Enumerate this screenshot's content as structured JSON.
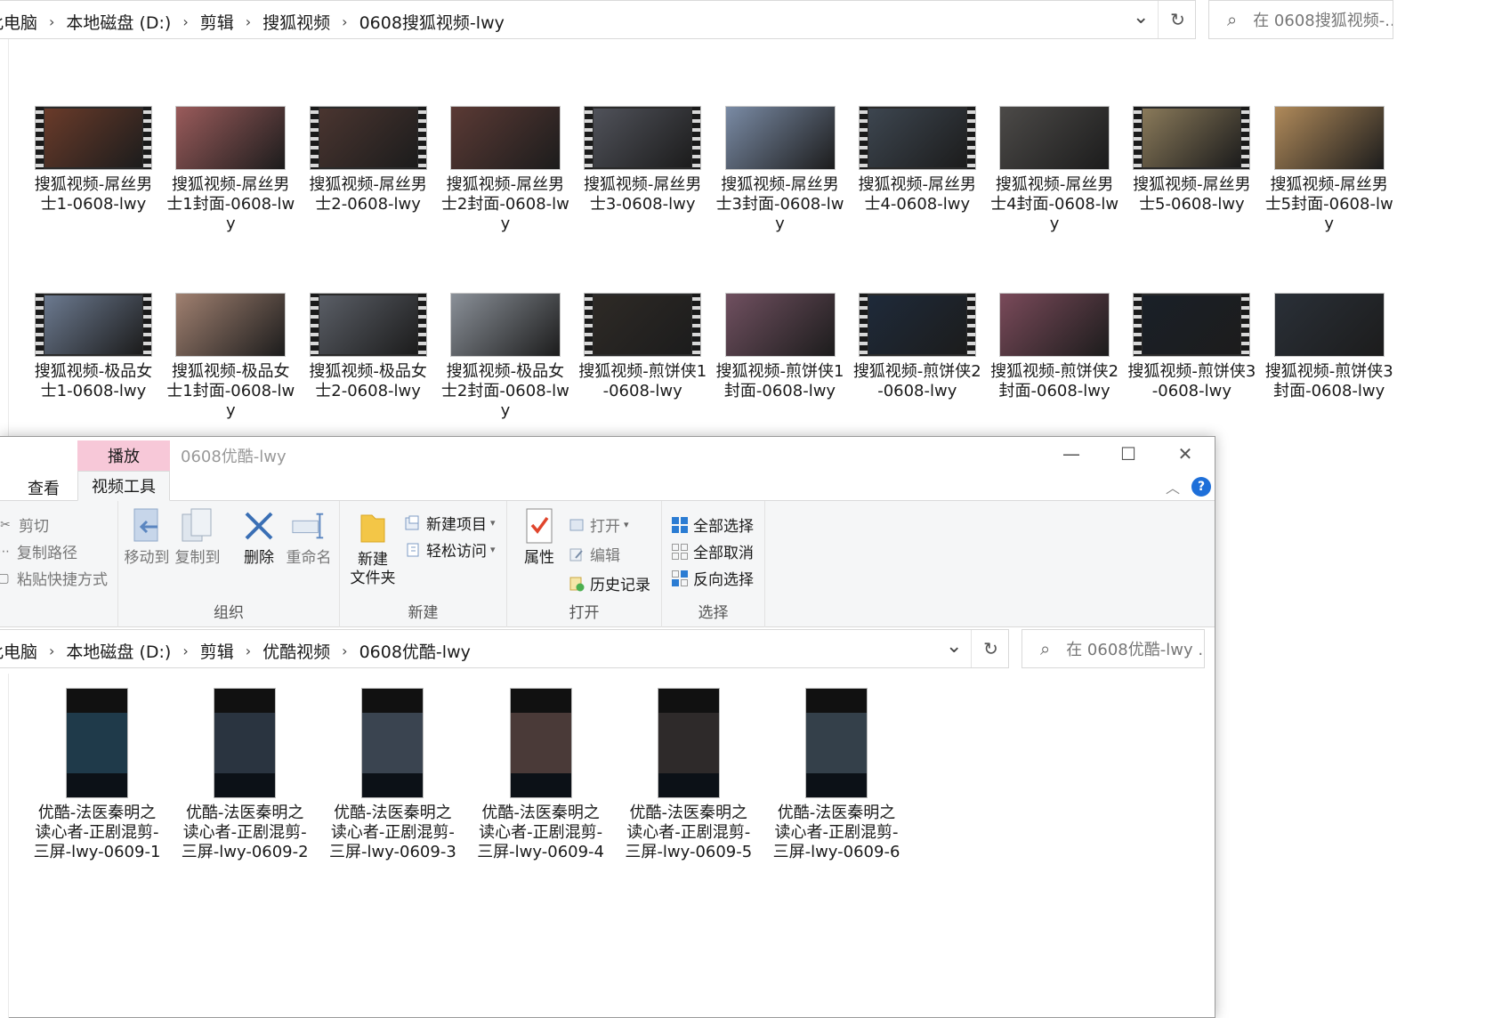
{
  "bg_window": {
    "breadcrumb": [
      "此电脑",
      "本地磁盘 (D:)",
      "剪辑",
      "搜狐视频",
      "0608搜狐视频-lwy"
    ],
    "breadcrumb_sep": "›",
    "dropdown_glyph": "⌄",
    "refresh_glyph": "↻",
    "search_icon": "⌕",
    "search_placeholder": "在 0608搜狐视频-...",
    "files_row1": [
      {
        "name": "搜狐视频-屌丝男士1-0608-lwy",
        "kind": "video",
        "tone": "#6a3b2a"
      },
      {
        "name": "搜狐视频-屌丝男士1封面-0608-lwy",
        "kind": "image",
        "tone": "#9a5b5b"
      },
      {
        "name": "搜狐视频-屌丝男士2-0608-lwy",
        "kind": "video",
        "tone": "#4a3530"
      },
      {
        "name": "搜狐视频-屌丝男士2封面-0608-lwy",
        "kind": "image",
        "tone": "#5b3a35"
      },
      {
        "name": "搜狐视频-屌丝男士3-0608-lwy",
        "kind": "video",
        "tone": "#50525a"
      },
      {
        "name": "搜狐视频-屌丝男士3封面-0608-lwy",
        "kind": "image",
        "tone": "#7a8ba5"
      },
      {
        "name": "搜狐视频-屌丝男士4-0608-lwy",
        "kind": "video",
        "tone": "#3d4650"
      },
      {
        "name": "搜狐视频-屌丝男士4封面-0608-lwy",
        "kind": "image",
        "tone": "#4c4a48"
      },
      {
        "name": "搜狐视频-屌丝男士5-0608-lwy",
        "kind": "video",
        "tone": "#8a7a5a"
      },
      {
        "name": "搜狐视频-屌丝男士5封面-0608-lwy",
        "kind": "image",
        "tone": "#b08a5a"
      }
    ],
    "files_row2": [
      {
        "name": "搜狐视频-极品女士1-0608-lwy",
        "kind": "video",
        "tone": "#6c7a90"
      },
      {
        "name": "搜狐视频-极品女士1封面-0608-lwy",
        "kind": "image",
        "tone": "#a08070"
      },
      {
        "name": "搜狐视频-极品女士2-0608-lwy",
        "kind": "video",
        "tone": "#5a5e66"
      },
      {
        "name": "搜狐视频-极品女士2封面-0608-lwy",
        "kind": "image",
        "tone": "#8a9098"
      },
      {
        "name": "搜狐视频-煎饼侠1-0608-lwy",
        "kind": "video",
        "tone": "#2e2a26"
      },
      {
        "name": "搜狐视频-煎饼侠1封面-0608-lwy",
        "kind": "image",
        "tone": "#705060"
      },
      {
        "name": "搜狐视频-煎饼侠2-0608-lwy",
        "kind": "video",
        "tone": "#1e2a3a"
      },
      {
        "name": "搜狐视频-煎饼侠2封面-0608-lwy",
        "kind": "image",
        "tone": "#7a4a5a"
      },
      {
        "name": "搜狐视频-煎饼侠3-0608-lwy",
        "kind": "video",
        "tone": "#1a2028"
      },
      {
        "name": "搜狐视频-煎饼侠3封面-0608-lwy",
        "kind": "image",
        "tone": "#2a3038"
      }
    ]
  },
  "fg_window": {
    "context_tab_header": "播放",
    "title": "0608优酷-lwy",
    "controls": {
      "minimize": "—",
      "maximize": "☐",
      "close": "✕"
    },
    "tabs": {
      "view": "查看",
      "video_tools": "视频工具"
    },
    "collapse_glyph": "︿",
    "help_glyph": "?",
    "ribbon": {
      "clipboard": {
        "cut": "剪切",
        "copy_path": "复制路径",
        "paste_shortcut": "粘贴快捷方式"
      },
      "organize": {
        "label": "组织",
        "move_to": "移动到",
        "copy_to": "复制到",
        "delete": "删除",
        "rename": "重命名"
      },
      "new": {
        "label": "新建",
        "new_folder_line1": "新建",
        "new_folder_line2": "文件夹",
        "new_item": "新建项目",
        "easy_access": "轻松访问"
      },
      "open": {
        "label": "打开",
        "properties": "属性",
        "open": "打开",
        "edit": "编辑",
        "history": "历史记录"
      },
      "select": {
        "label": "选择",
        "select_all": "全部选择",
        "select_none": "全部取消",
        "invert": "反向选择"
      }
    },
    "breadcrumb": [
      "此电脑",
      "本地磁盘 (D:)",
      "剪辑",
      "优酷视频",
      "0608优酷-lwy"
    ],
    "search_placeholder": "在 0608优酷-lwy ...",
    "files": [
      {
        "name": "优酷-法医秦明之读心者-正剧混剪-三屏-lwy-0609-1",
        "tone": "#1f3a4a"
      },
      {
        "name": "优酷-法医秦明之读心者-正剧混剪-三屏-lwy-0609-2",
        "tone": "#2a3440"
      },
      {
        "name": "优酷-法医秦明之读心者-正剧混剪-三屏-lwy-0609-3",
        "tone": "#3a4450"
      },
      {
        "name": "优酷-法医秦明之读心者-正剧混剪-三屏-lwy-0609-4",
        "tone": "#4a3a38"
      },
      {
        "name": "优酷-法医秦明之读心者-正剧混剪-三屏-lwy-0609-5",
        "tone": "#2e2a2a"
      },
      {
        "name": "优酷-法医秦明之读心者-正剧混剪-三屏-lwy-0609-6",
        "tone": "#34404a"
      }
    ]
  },
  "colors": {
    "context_tab": "#f7c8d8",
    "ribbon_bg": "#f5f6f7",
    "help_blue": "#1e6fd9",
    "select_blue": "#2b7cd3"
  }
}
